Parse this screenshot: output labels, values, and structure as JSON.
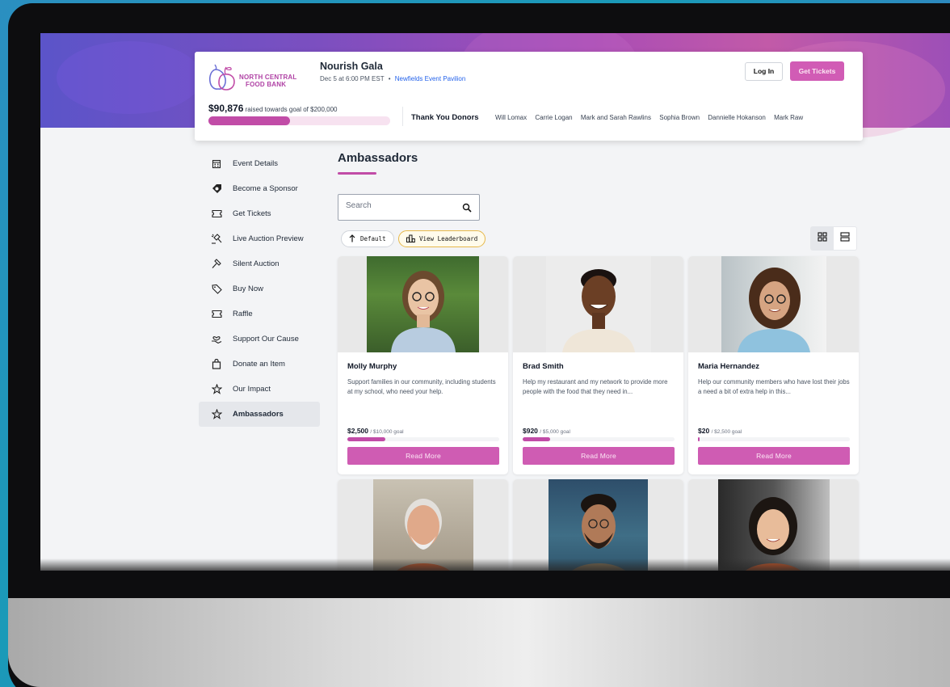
{
  "event": {
    "org_logo_text_1": "NORTH CENTRAL",
    "org_logo_text_2": "FOOD BANK",
    "title": "Nourish Gala",
    "date": "Dec 5 at 6:00 PM EST",
    "bullet": "•",
    "venue": "Newfields Event Pavilion"
  },
  "header": {
    "login_label": "Log In",
    "get_tickets_label": "Get Tickets"
  },
  "fundraising": {
    "raised_amount": "$90,876",
    "raised_text": "raised towards goal of $200,000",
    "progress_fraction": 0.45
  },
  "donors": {
    "title": "Thank You Donors",
    "names": [
      "Will Lomax",
      "Carrie Logan",
      "Mark and Sarah Rawlins",
      "Sophia Brown",
      "Dannielle Hokanson",
      "Mark Raw"
    ]
  },
  "sidebar": {
    "items": [
      {
        "label": "Event Details",
        "icon": "calendar-icon"
      },
      {
        "label": "Become a Sponsor",
        "icon": "tag-heart-icon"
      },
      {
        "label": "Get Tickets",
        "icon": "ticket-icon"
      },
      {
        "label": "Live Auction Preview",
        "icon": "gavel-icon"
      },
      {
        "label": "Silent Auction",
        "icon": "hammer-icon"
      },
      {
        "label": "Buy Now",
        "icon": "price-tag-icon"
      },
      {
        "label": "Raffle",
        "icon": "ticket-icon"
      },
      {
        "label": "Support Our Cause",
        "icon": "hand-heart-icon"
      },
      {
        "label": "Donate an Item",
        "icon": "bag-icon"
      },
      {
        "label": "Our Impact",
        "icon": "star-icon"
      },
      {
        "label": "Ambassadors",
        "icon": "star-icon",
        "active": true
      }
    ]
  },
  "main": {
    "title": "Ambassadors",
    "search_placeholder": "Search",
    "sort_default_label": "Default",
    "leaderboard_label": "View Leaderboard"
  },
  "ambassadors": [
    {
      "name": "Molly Murphy",
      "description": "Support families in our community, including students at my school, who need your help.",
      "raised": "$2,500",
      "goal": "/ $10,000 goal",
      "progress": 0.25,
      "button": "Read More"
    },
    {
      "name": "Brad Smith",
      "description": "Help my restaurant and my network to provide more people with the food that they need in...",
      "raised": "$920",
      "goal": "/ $5,000 goal",
      "progress": 0.18,
      "button": "Read More"
    },
    {
      "name": "Maria Hernandez",
      "description": "Help our community members who have lost their jobs a need a bit of extra help in this...",
      "raised": "$20",
      "goal": "/ $2,500 goal",
      "progress": 0.008,
      "button": "Read More"
    }
  ],
  "colors": {
    "brand": "#c14ca7",
    "button": "#cf5cb3",
    "banner_start": "#5b54c9",
    "banner_end": "#c25aa8"
  }
}
